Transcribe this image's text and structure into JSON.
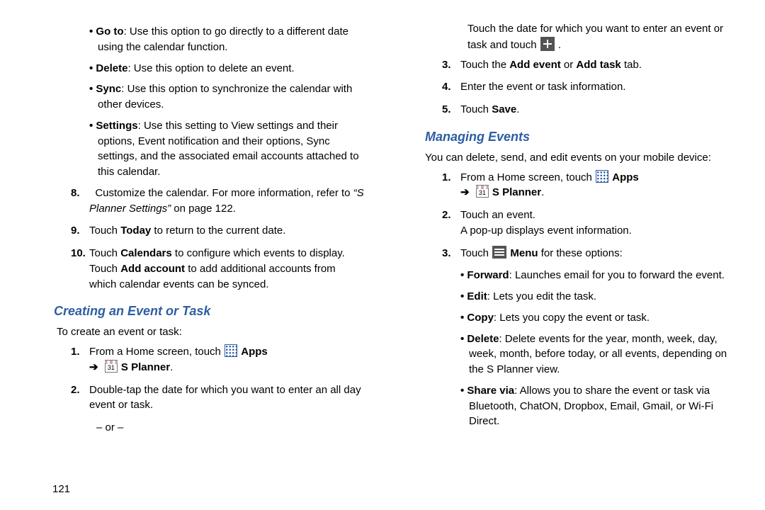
{
  "page_number": "121",
  "left": {
    "top_bullets": [
      {
        "label": "Go to",
        "desc": ": Use this option to go directly to a different date using the calendar function."
      },
      {
        "label": "Delete",
        "desc": ": Use this option to delete an event."
      },
      {
        "label": "Sync",
        "desc": ": Use this option to synchronize the calendar with other devices."
      },
      {
        "label": "Settings",
        "desc": ": Use this setting to View settings and their options, Event notification and their options, Sync settings, and the associated email accounts attached to this calendar."
      }
    ],
    "num8_prefix": "Customize the calendar. For more information, refer to ",
    "num8_ref": "“S Planner Settings”",
    "num8_suffix": " on page 122.",
    "num9_a": "Touch ",
    "num9_b": "Today",
    "num9_c": " to return to the current date.",
    "num10_a": "Touch ",
    "num10_b": "Calendars",
    "num10_c": " to configure which events to display. Touch ",
    "num10_d": "Add account",
    "num10_e": " to add additional accounts from which calendar events can be synced.",
    "subhead": "Creating an Event or Task",
    "intro": "To create an event or task:",
    "step1_a": "From a Home screen, touch ",
    "apps_label": "Apps",
    "splanner_label": "S Planner",
    "step2": "Double-tap the date for which you want to enter an all day event or task.",
    "or_note": "– or –"
  },
  "right": {
    "cont_line": "Touch the date for which you want to enter an event or task and touch ",
    "period": ".",
    "step3_a": "Touch the ",
    "step3_b": "Add event",
    "step3_c": " or ",
    "step3_d": "Add task",
    "step3_e": "  tab.",
    "step4": "Enter the event or task information.",
    "step5_a": "Touch ",
    "step5_b": "Save",
    "step5_c": ".",
    "subhead": "Managing Events",
    "intro": "You can delete, send, and edit events on your mobile device:",
    "m1_a": "From a Home screen, touch ",
    "apps_label": "Apps",
    "splanner_label": "S Planner",
    "m2_a": "Touch an event.",
    "m2_b": "A pop-up displays event information.",
    "m3_a": "Touch ",
    "m3_b": "Menu",
    "m3_c": " for these options:",
    "menu_opts": [
      {
        "label": "Forward",
        "desc": ": Launches email for you to forward the event."
      },
      {
        "label": "Edit",
        "desc": ": Lets you edit the task."
      },
      {
        "label": "Copy",
        "desc": ": Lets you copy the event or task."
      },
      {
        "label": "Delete",
        "desc": ": Delete events for the year, month, week, day, week, month, before today, or all events, depending on the S Planner view."
      },
      {
        "label": "Share via",
        "desc": ": Allows you to share the event or task via Bluetooth, ChatON, Dropbox, Email, Gmail, or Wi-Fi Direct."
      }
    ]
  }
}
